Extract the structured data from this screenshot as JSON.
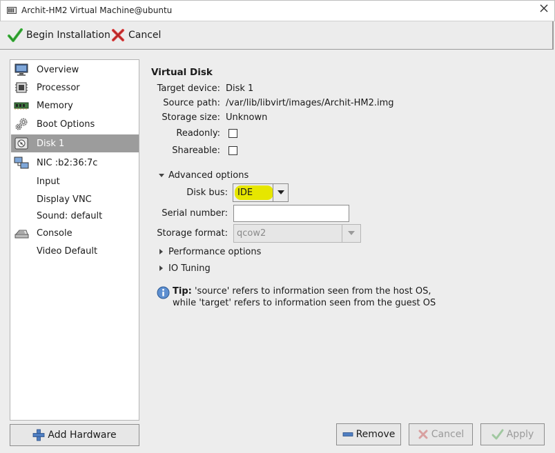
{
  "window": {
    "title": "Archit-HM2 Virtual Machine@ubuntu",
    "close_label": "✕"
  },
  "toolbar": {
    "begin_label": "Begin Installation",
    "cancel_label": "Cancel"
  },
  "sidebar": {
    "items": [
      {
        "label": "Overview",
        "icon": "monitor-icon"
      },
      {
        "label": "Processor",
        "icon": "cpu-icon"
      },
      {
        "label": "Memory",
        "icon": "memory-icon"
      },
      {
        "label": "Boot Options",
        "icon": "gears-icon"
      },
      {
        "label": "Disk 1",
        "icon": "disk-icon",
        "selected": true
      },
      {
        "label": "NIC :b2:36:7c",
        "icon": "network-icon"
      },
      {
        "label": "Input",
        "icon": ""
      },
      {
        "label": "Display VNC",
        "icon": ""
      },
      {
        "label": "Sound: default",
        "icon": ""
      },
      {
        "label": "Console",
        "icon": "console-icon"
      },
      {
        "label": "Video Default",
        "icon": ""
      }
    ]
  },
  "detail": {
    "section_title": "Virtual Disk",
    "target_device_label": "Target device:",
    "target_device_value": "Disk 1",
    "source_path_label": "Source path:",
    "source_path_value": "/var/lib/libvirt/images/Archit-HM2.img",
    "storage_size_label": "Storage size:",
    "storage_size_value": "Unknown",
    "readonly_label": "Readonly:",
    "readonly_checked": false,
    "shareable_label": "Shareable:",
    "shareable_checked": false,
    "advanced_label": "Advanced options",
    "disk_bus_label": "Disk bus:",
    "disk_bus_value": "IDE",
    "serial_label": "Serial number:",
    "serial_value": "",
    "storage_format_label": "Storage format:",
    "storage_format_value": "qcow2",
    "performance_label": "Performance options",
    "io_tuning_label": "IO Tuning",
    "tip_bold": "Tip:",
    "tip_line1": "'source' refers to information seen from the host OS,",
    "tip_line2": "while 'target' refers to information seen from the guest OS"
  },
  "buttons": {
    "add_hardware": "Add Hardware",
    "remove": "Remove",
    "cancel": "Cancel",
    "apply": "Apply"
  },
  "colors": {
    "highlight": "#e6e600",
    "selected_row": "#9c9c9c",
    "accept_green": "#3db33d",
    "cancel_red": "#d93a3a"
  }
}
